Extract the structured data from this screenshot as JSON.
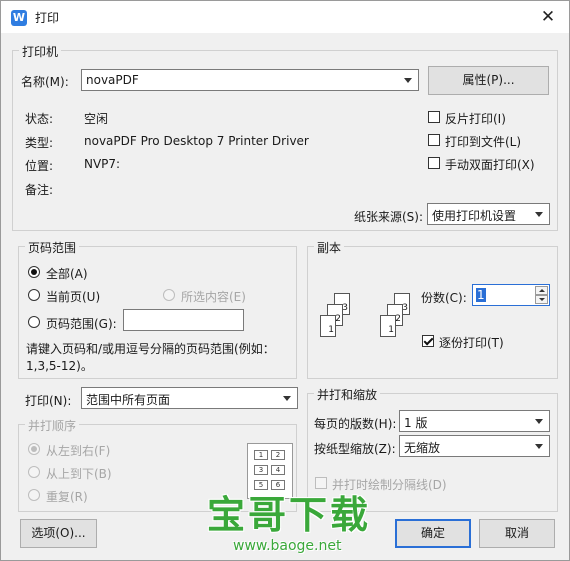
{
  "window": {
    "title": "打印",
    "close_glyph": "✕",
    "app_icon_letter": "W"
  },
  "printer": {
    "legend": "打印机",
    "name_label": "名称(M):",
    "name_value": "novaPDF",
    "properties_button": "属性(P)...",
    "status_label": "状态:",
    "status_value": "空闲",
    "type_label": "类型:",
    "type_value": "novaPDF Pro Desktop 7 Printer Driver",
    "location_label": "位置:",
    "location_value": "NVP7:",
    "comment_label": "备注:",
    "reverse_print": {
      "label": "反片打印(I)",
      "checked": false
    },
    "print_to_file": {
      "label": "打印到文件(L)",
      "checked": false
    },
    "manual_duplex": {
      "label": "手动双面打印(X)",
      "checked": false
    },
    "paper_source_label": "纸张来源(S):",
    "paper_source_value": "使用打印机设置"
  },
  "page_range": {
    "legend": "页码范围",
    "all": {
      "label": "全部(A)",
      "selected": true
    },
    "current": {
      "label": "当前页(U)",
      "selected": false
    },
    "selection": {
      "label": "所选内容(E)",
      "selected": false,
      "disabled": true
    },
    "pages": {
      "label": "页码范围(G):",
      "selected": false,
      "value": ""
    },
    "hint_line1": "请键入页码和/或用逗号分隔的页码范围(例如：",
    "hint_line2": "1,3,5-12)。"
  },
  "print_what": {
    "label": "打印(N):",
    "value": "范围中所有页面"
  },
  "collate_order": {
    "legend": "并打顺序",
    "left_to_right": {
      "label": "从左到右(F)",
      "selected": true
    },
    "top_to_bottom": {
      "label": "从上到下(B)",
      "selected": false
    },
    "repeat": {
      "label": "重复(R)",
      "selected": false
    },
    "grid_numbers": [
      "1",
      "2",
      "3",
      "4",
      "5",
      "6"
    ]
  },
  "copies": {
    "legend": "副本",
    "count_label": "份数(C):",
    "count_value": "1",
    "collate": {
      "label": "逐份打印(T)",
      "checked": true
    },
    "page_numbers": [
      "1",
      "2",
      "3"
    ]
  },
  "zoom": {
    "legend": "并打和缩放",
    "pages_per_sheet_label": "每页的版数(H):",
    "pages_per_sheet_value": "1 版",
    "scale_label": "按纸型缩放(Z):",
    "scale_value": "无缩放",
    "draw_borders": {
      "label": "并打时绘制分隔线(D)",
      "checked": false
    }
  },
  "buttons": {
    "options": "选项(O)...",
    "ok": "确定",
    "cancel": "取消"
  },
  "watermark": {
    "main": "宝哥下载",
    "url": "www.baoge.net"
  },
  "colors": {
    "accent": "#2a6fd6",
    "watermark_green": "#3aa83a"
  }
}
